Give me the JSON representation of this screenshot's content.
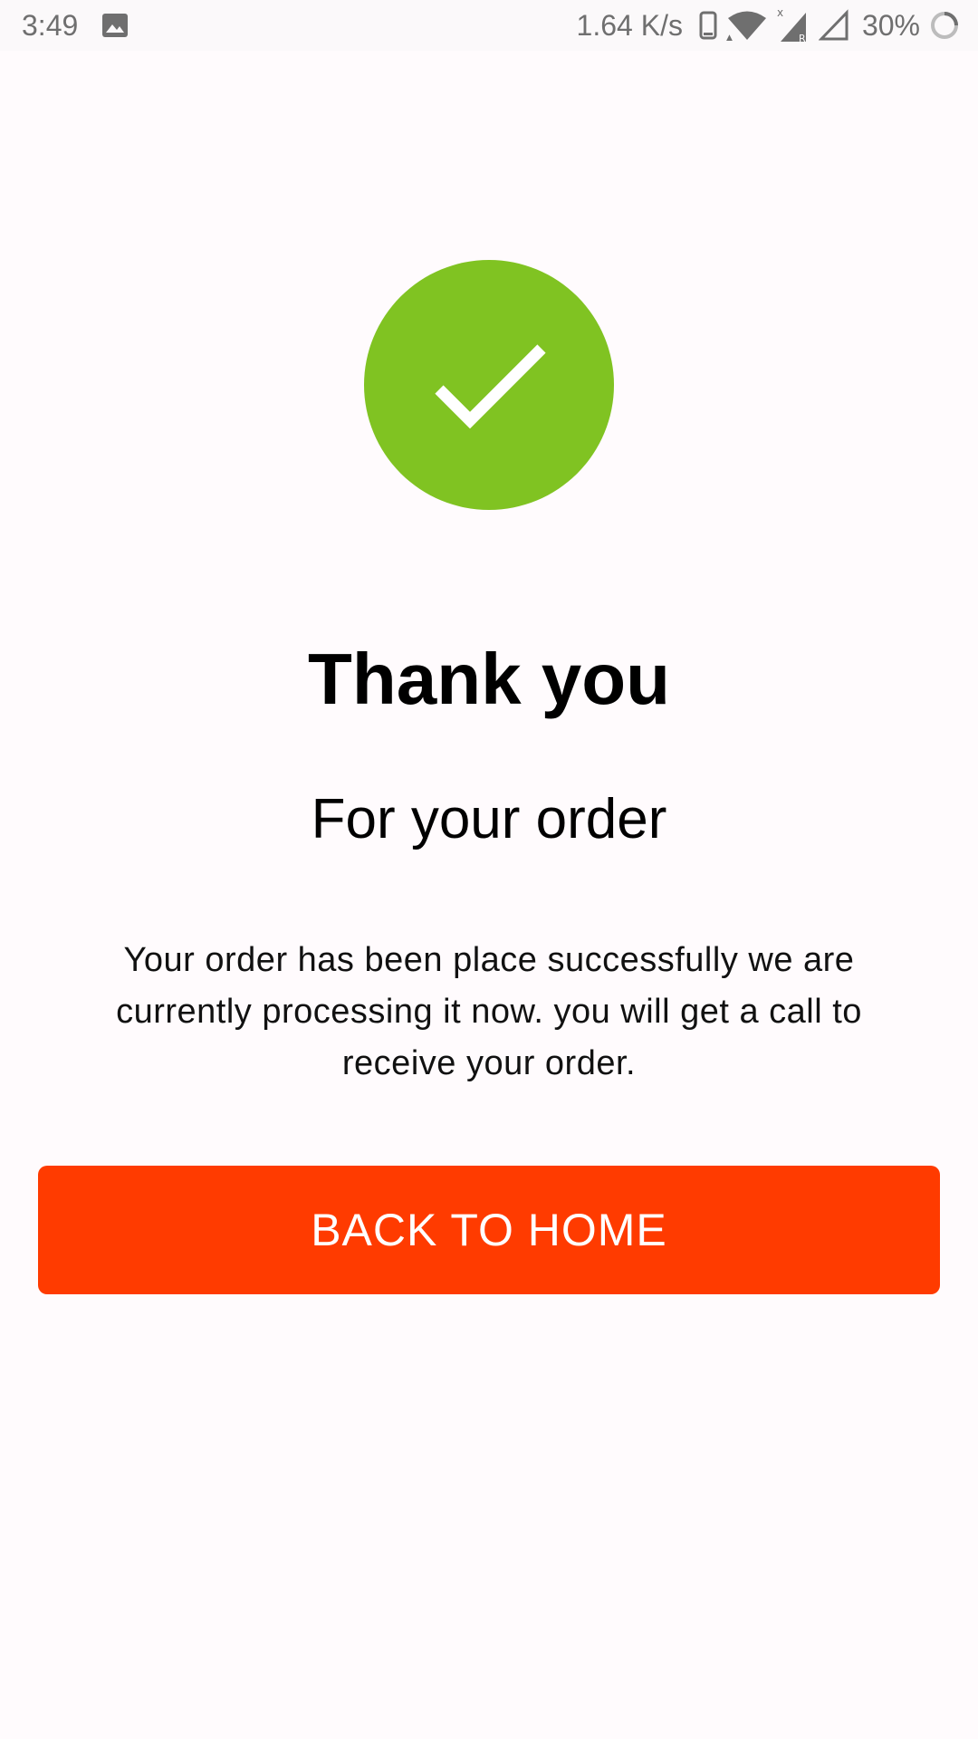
{
  "status_bar": {
    "time": "3:49",
    "network_speed": "1.64 K/s",
    "battery_percent": "30%",
    "icons": [
      "gallery-icon",
      "phone-icon",
      "wifi-icon",
      "signal-icon",
      "signal-empty-icon",
      "battery-loading-icon"
    ]
  },
  "success": {
    "icon": "check-circle-icon",
    "color": "#80c322"
  },
  "content": {
    "title": "Thank you",
    "subtitle": "For your order",
    "message": "Your order has been place successfully we are currently processing it now. you will get a call to receive your order."
  },
  "actions": {
    "back_home_label": "BACK TO HOME",
    "button_color": "#ff3b00"
  }
}
